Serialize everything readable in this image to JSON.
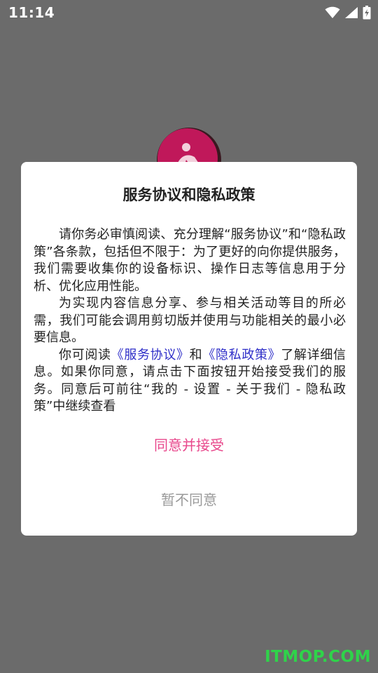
{
  "status_bar": {
    "time": "11:14",
    "icons": [
      "wifi-icon",
      "signal-icon",
      "battery-charging-icon"
    ]
  },
  "dialog": {
    "title": "服务协议和隐私政策",
    "p1": "请你务必审慎阅读、充分理解“服务协议”和“隐私政策”各条款，包括但不限于：为了更好的向你提供服务，我们需要收集你的设备标识、操作日志等信息用于分析、优化应用性能。",
    "p2": "为实现内容信息分享、参与相关活动等目的所必需，我们可能会调用剪切版并使用与功能相关的最小必要信息。",
    "p3_pre": "你可阅读",
    "p3_link1": "《服务协议》",
    "p3_mid": "和",
    "p3_link2": "《隐私政策》",
    "p3_post": "了解详细信息。如果你同意，请点击下面按钮开始接受我们的服务。同意后可前往“我的 - 设置 - 关于我们 - 隐私政策”中继续查看",
    "accept_label": "同意并接受",
    "decline_label": "暂不同意"
  },
  "colors": {
    "accent": "#e8488c",
    "link": "#2e2ec8",
    "overlay": "#6b6b6b",
    "decline": "#9a9a9a",
    "watermark": "#2fd34a"
  },
  "watermark": "ITMOP.COM"
}
